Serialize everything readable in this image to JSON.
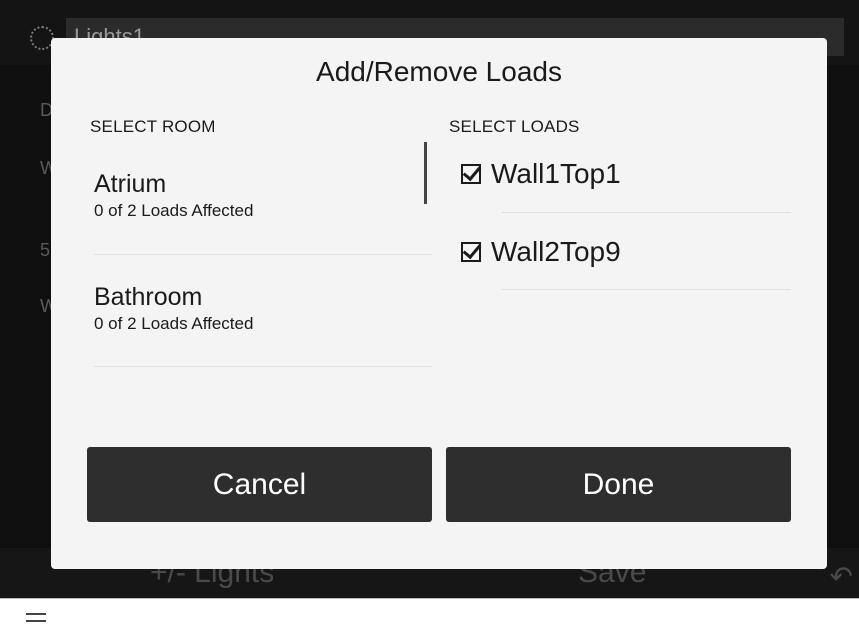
{
  "background": {
    "title_value": "Lights1",
    "left_labels": [
      "D",
      "W",
      "5",
      "W"
    ],
    "bottom_left_label": "+/- Lights",
    "bottom_right_label": "Save"
  },
  "modal": {
    "title": "Add/Remove Loads",
    "select_room_header": "SELECT ROOM",
    "select_loads_header": "SELECT LOADS",
    "rooms": [
      {
        "name": "Atrium",
        "status": "0 of 2 Loads Affected"
      },
      {
        "name": "Bathroom",
        "status": "0 of 2 Loads Affected"
      }
    ],
    "loads": [
      {
        "label": "Wall1Top1",
        "checked": true
      },
      {
        "label": "Wall2Top9",
        "checked": true
      }
    ],
    "cancel_label": "Cancel",
    "done_label": "Done"
  },
  "icons": {
    "settings": "gear-icon",
    "back": "back-arrow-icon",
    "menu": "hamburger-menu-icon",
    "check": "checkbox-checked-icon"
  },
  "colors": {
    "modal_bg": "#f4f4f4",
    "button_bg": "#2e2e2e",
    "screen_bg": "#0f0f0f"
  }
}
